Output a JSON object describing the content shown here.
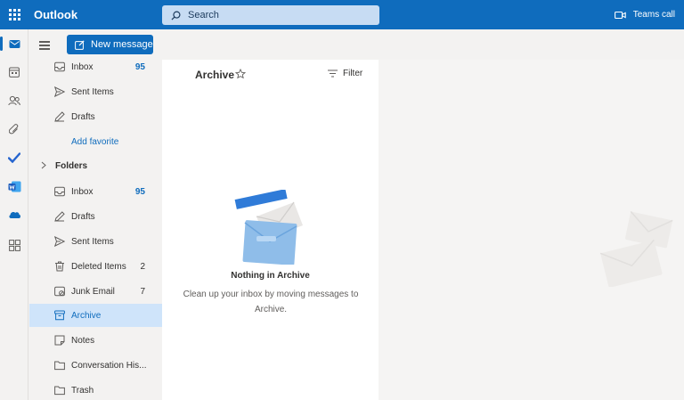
{
  "app": {
    "name": "Outlook",
    "search_placeholder": "Search",
    "teams_call_label": "Teams call",
    "accent_color": "#0f6cbd"
  },
  "rail": {
    "icons": [
      "mail-icon",
      "calendar-icon",
      "people-icon",
      "attachment-icon",
      "todo-icon",
      "word-icon",
      "onedrive-icon",
      "apps-icon"
    ],
    "active": "mail-icon"
  },
  "toolbar": {
    "new_message_label": "New message"
  },
  "favorites": [
    {
      "label": "Inbox",
      "count": "95",
      "icon": "inbox-icon"
    },
    {
      "label": "Sent Items",
      "count": "",
      "icon": "send-icon"
    },
    {
      "label": "Drafts",
      "count": "",
      "icon": "pencil-icon"
    }
  ],
  "add_favorite_label": "Add favorite",
  "folders_header": "Folders",
  "folders": [
    {
      "label": "Inbox",
      "count": "95",
      "icon": "inbox-icon"
    },
    {
      "label": "Drafts",
      "count": "",
      "icon": "pencil-icon"
    },
    {
      "label": "Sent Items",
      "count": "",
      "icon": "send-icon"
    },
    {
      "label": "Deleted Items",
      "count": "2",
      "icon": "trash-icon"
    },
    {
      "label": "Junk Email",
      "count": "7",
      "icon": "junk-icon"
    },
    {
      "label": "Archive",
      "count": "",
      "icon": "archive-icon",
      "selected": true
    },
    {
      "label": "Notes",
      "count": "",
      "icon": "note-icon"
    },
    {
      "label": "Conversation His...",
      "count": "",
      "icon": "folder-icon"
    },
    {
      "label": "Trash",
      "count": "",
      "icon": "folder-icon"
    }
  ],
  "message_list": {
    "title": "Archive",
    "filter_label": "Filter",
    "empty_title": "Nothing in Archive",
    "empty_subtitle": "Clean up your inbox by moving messages to Archive."
  }
}
